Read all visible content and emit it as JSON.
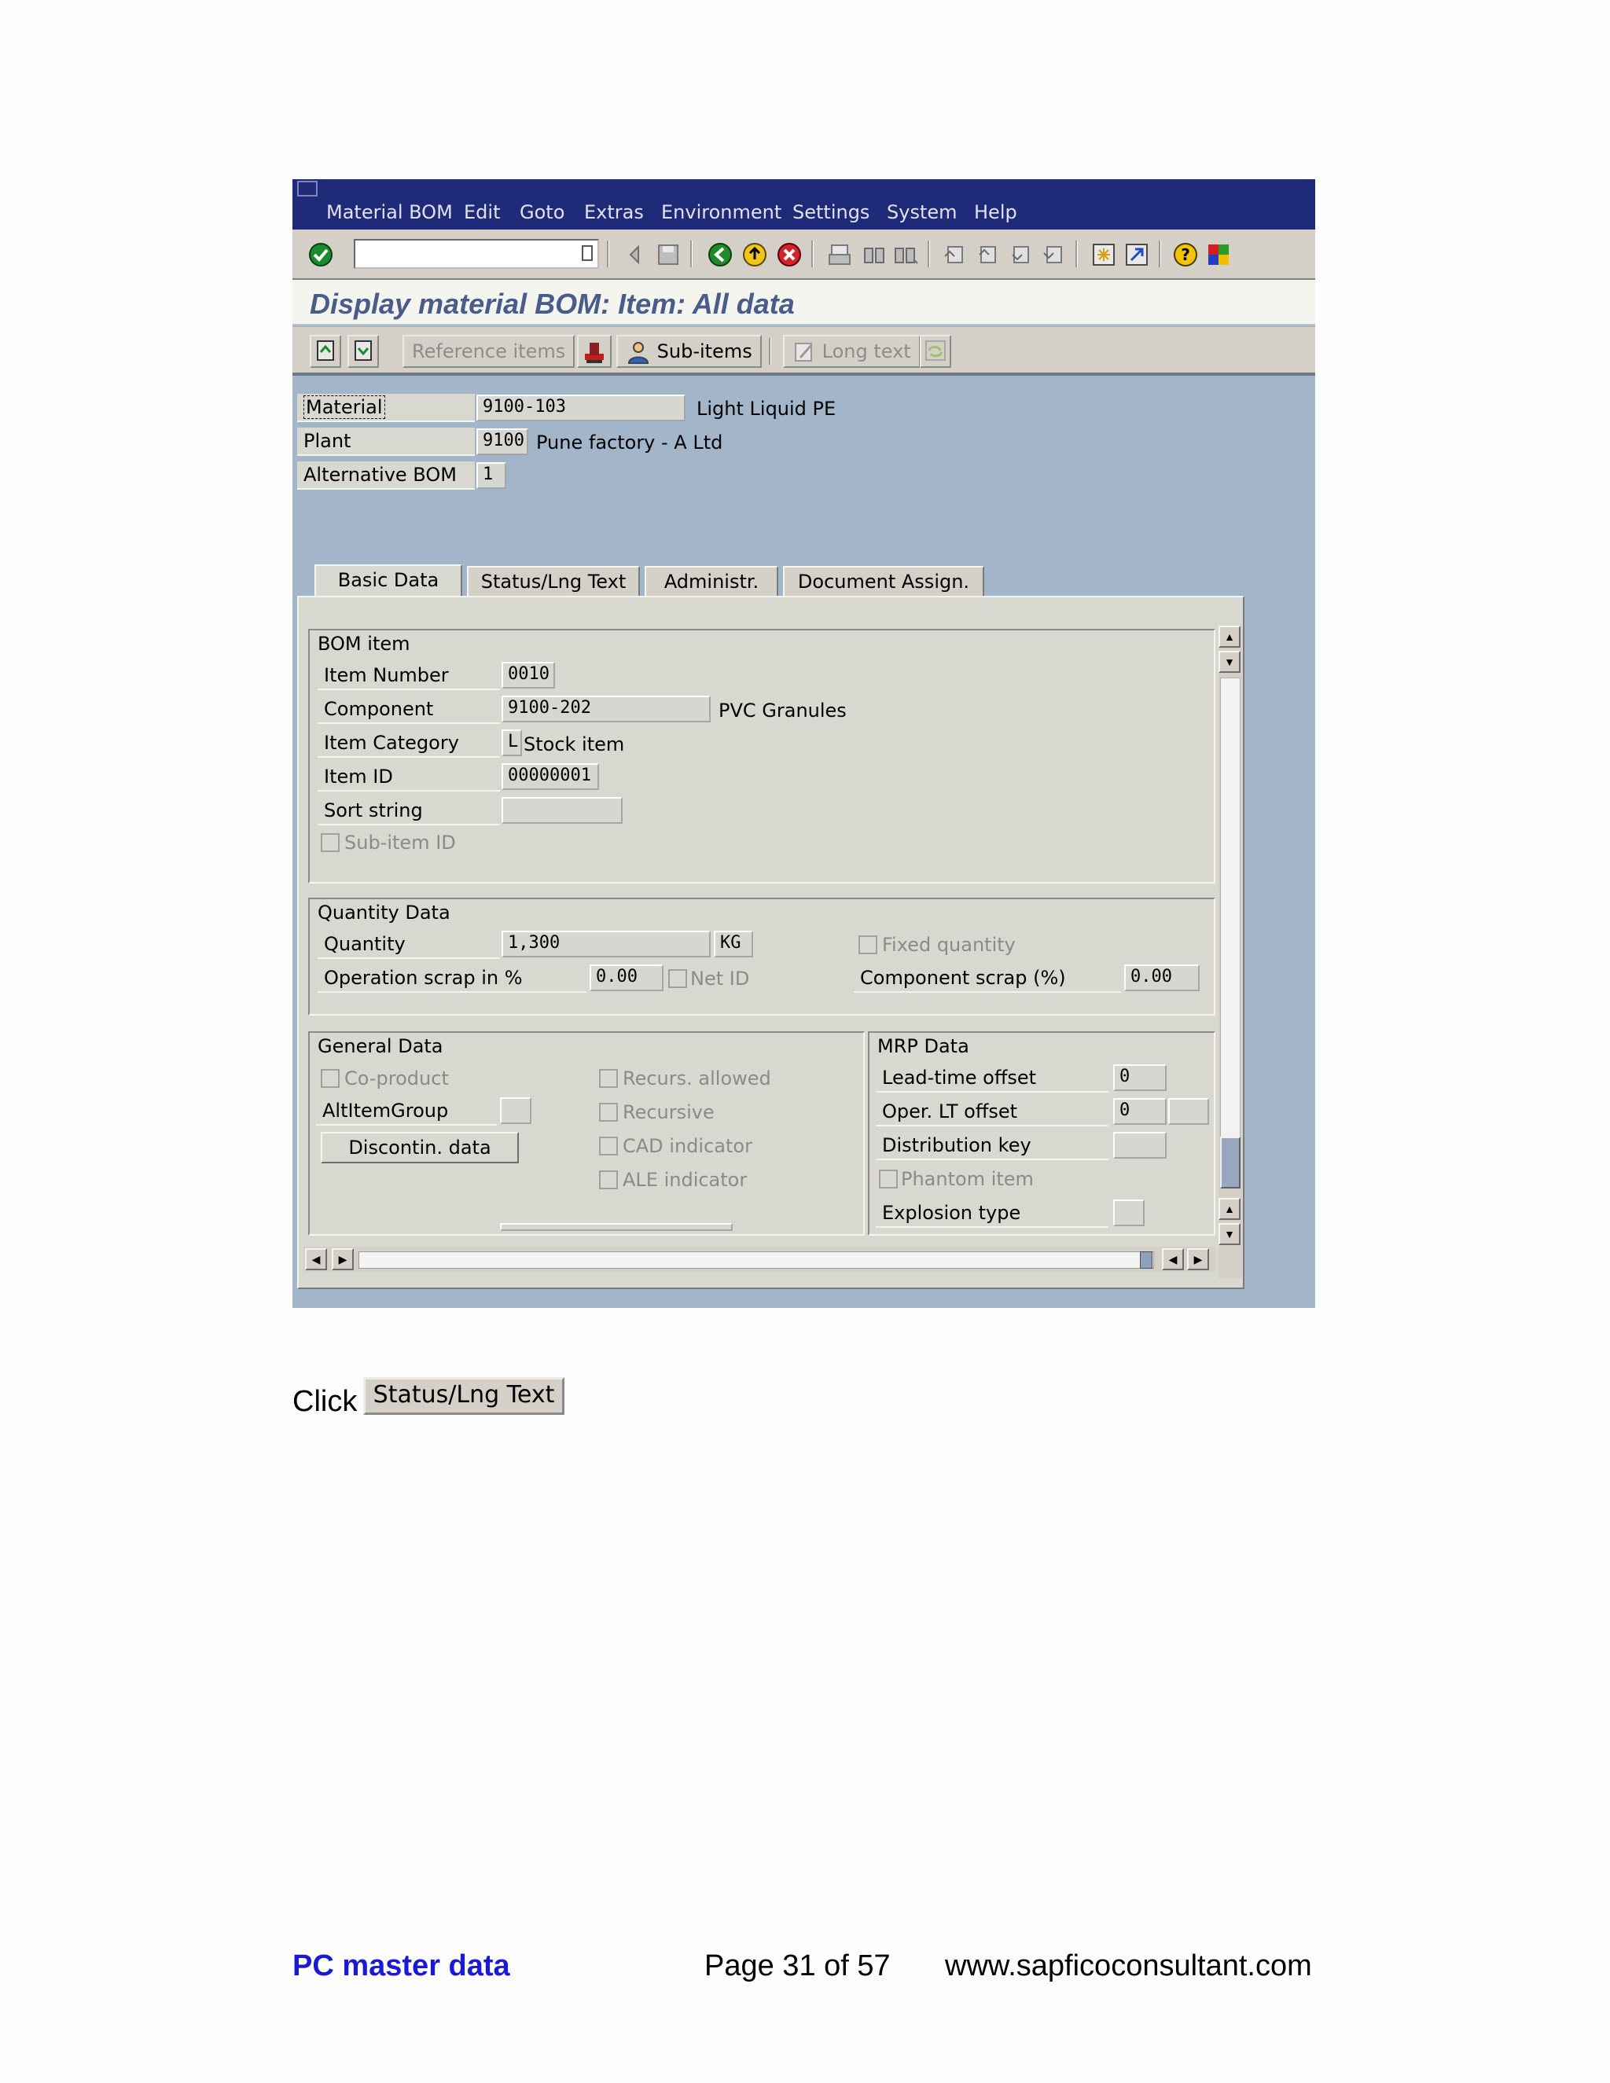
{
  "menu": {
    "items": [
      "Material BOM",
      "Edit",
      "Goto",
      "Extras",
      "Environment",
      "Settings",
      "System",
      "Help"
    ]
  },
  "title": "Display material BOM: Item: All data",
  "app_toolbar": {
    "reference_items": "Reference items",
    "sub_items": "Sub-items",
    "long_text": "Long text"
  },
  "header_fields": {
    "material_label": "Material",
    "material_value": "9100-103",
    "material_desc": "Light Liquid PE",
    "plant_label": "Plant",
    "plant_value": "9100",
    "plant_desc": "Pune factory -  A Ltd",
    "alt_bom_label": "Alternative BOM",
    "alt_bom_value": "1"
  },
  "tabs": [
    "Basic Data",
    "Status/Lng Text",
    "Administr.",
    "Document Assign."
  ],
  "bom_item": {
    "title": "BOM item",
    "item_number_label": "Item Number",
    "item_number": "0010",
    "component_label": "Component",
    "component": "9100-202",
    "component_desc": "PVC Granules",
    "item_category_label": "Item Category",
    "item_category": "L",
    "item_category_desc": "Stock item",
    "item_id_label": "Item ID",
    "item_id": "00000001",
    "sort_string_label": "Sort string",
    "sort_string": "",
    "sub_item_id_label": "Sub-item ID"
  },
  "quantity_data": {
    "title": "Quantity Data",
    "quantity_label": "Quantity",
    "quantity": "1,300",
    "unit": "KG",
    "fixed_qty_label": "Fixed quantity",
    "op_scrap_label": "Operation scrap in %",
    "op_scrap": "0.00",
    "net_id_label": "Net ID",
    "comp_scrap_label": "Component scrap (%)",
    "comp_scrap": "0.00"
  },
  "general_data": {
    "title": "General Data",
    "co_product_label": "Co-product",
    "alt_item_group_label": "AltItemGroup",
    "discontin_button": "Discontin. data",
    "recurs_allowed_label": "Recurs. allowed",
    "recursive_label": "Recursive",
    "cad_indicator_label": "CAD indicator",
    "ale_indicator_label": "ALE indicator"
  },
  "mrp_data": {
    "title": "MRP Data",
    "lead_time_label": "Lead-time offset",
    "lead_time": "0",
    "oper_lt_label": "Oper. LT offset",
    "oper_lt": "0",
    "distribution_key_label": "Distribution key",
    "phantom_item_label": "Phantom item",
    "explosion_type_label": "Explosion type"
  },
  "instruction": {
    "prefix": "Click",
    "button_label": "Status/Lng Text"
  },
  "footer": {
    "left": "PC master data",
    "center": "Page 31 of 57",
    "right": "www.sapficoconsultant.com"
  },
  "colors": {
    "menubar": "#1f2a78",
    "window_bg": "#a3b6c9",
    "footer_left": "#1a1ad6"
  }
}
